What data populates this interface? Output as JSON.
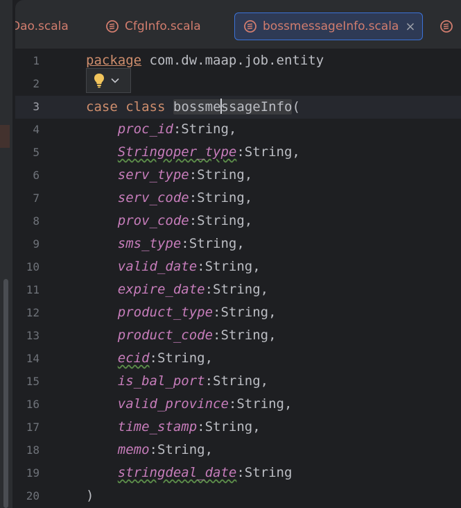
{
  "tabs": [
    {
      "label": "Dao.scala",
      "icon": "scala-file-icon",
      "active": false
    },
    {
      "label": "CfgInfo.scala",
      "icon": "scala-file-icon",
      "active": false
    },
    {
      "label": "bossmessageInfo.scala",
      "icon": "scala-file-icon",
      "active": true,
      "close": "×"
    },
    {
      "label": "",
      "icon": "scala-file-icon",
      "active": false
    }
  ],
  "editor": {
    "current_line": 3,
    "lines": [
      {
        "n": "1",
        "package_kw": "package",
        "package_name": " com.dw.maap.job.entity"
      },
      {
        "n": "2"
      },
      {
        "n": "3",
        "kw_case": "case",
        "kw_class": "class",
        "class_name_a": "bossme",
        "class_name_b": "ssageInfo",
        "open": "("
      },
      {
        "n": "4",
        "param": "proc_id",
        "type": ":String,"
      },
      {
        "n": "5",
        "param": "Stringoper_type",
        "type": ":String,"
      },
      {
        "n": "6",
        "param": "serv_type",
        "type": ":String,"
      },
      {
        "n": "7",
        "param": "serv_code",
        "type": ":String,"
      },
      {
        "n": "8",
        "param": "prov_code",
        "type": ":String,"
      },
      {
        "n": "9",
        "param": "sms_type",
        "type": ":String,"
      },
      {
        "n": "10",
        "param": "valid_date",
        "type": ":String,"
      },
      {
        "n": "11",
        "param": "expire_date",
        "type": ":String,"
      },
      {
        "n": "12",
        "param": "product_type",
        "type": ":String,"
      },
      {
        "n": "13",
        "param": "product_code",
        "type": ":String,"
      },
      {
        "n": "14",
        "param": "ecid",
        "type": ":String,"
      },
      {
        "n": "15",
        "param": "is_bal_port",
        "type": ":String,"
      },
      {
        "n": "16",
        "param": "valid_province",
        "type": ":String,"
      },
      {
        "n": "17",
        "param": "time_stamp",
        "type": ":String,"
      },
      {
        "n": "18",
        "param": "memo",
        "type": ":String,"
      },
      {
        "n": "19",
        "param": "stringdeal_date",
        "type": ":String"
      },
      {
        "n": "20",
        "close": ")"
      }
    ]
  },
  "intention_popup": {
    "icon": "lightbulb-icon",
    "chevron": "chevron-down-icon"
  },
  "colors": {
    "keyword": "#cf8e6d",
    "parameter": "#c77dbb",
    "text": "#bcbec4",
    "line_number": "#6f737a",
    "active_tab_border": "#3b73d8",
    "tab_text": "#d27d6e"
  }
}
